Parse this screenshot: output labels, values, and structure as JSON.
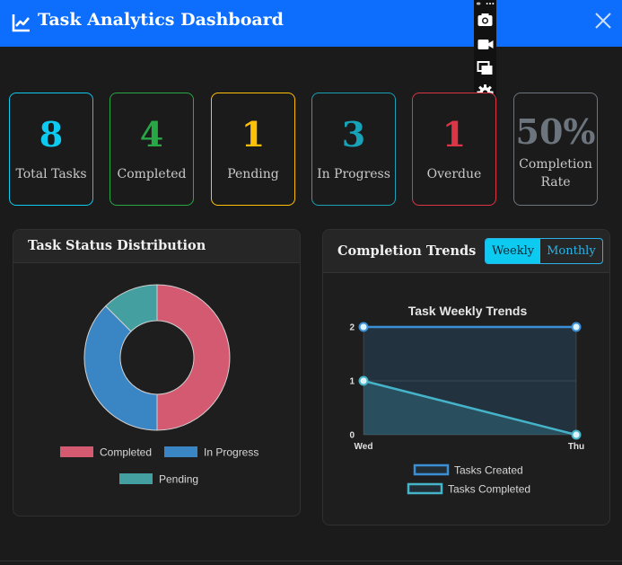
{
  "header": {
    "title": "Task Analytics Dashboard",
    "logo_icon": "chart-line-icon",
    "close_icon": "close-icon",
    "bg_color": "#0d6efd"
  },
  "recorder": {
    "icons": [
      "link-icon",
      "more-icon",
      "camera-icon",
      "video-icon",
      "window-icon",
      "gear-icon"
    ]
  },
  "stats": [
    {
      "value": "8",
      "label": "Total Tasks",
      "color": "#0dcaf0",
      "border": "#0dcaf0"
    },
    {
      "value": "4",
      "label": "Completed",
      "color": "#28a745",
      "border": "#28a745"
    },
    {
      "value": "1",
      "label": "Pending",
      "color": "#ffc107",
      "border": "#ffc107"
    },
    {
      "value": "3",
      "label": "In Progress",
      "color": "#17a2b8",
      "border": "#17a2b8"
    },
    {
      "value": "1",
      "label": "Overdue",
      "color": "#dc3545",
      "border": "#dc3545"
    },
    {
      "value": "50%",
      "label_line1": "Completion",
      "label_line2": "Rate",
      "color": "#6c757d",
      "border": "#6c757d"
    }
  ],
  "status_panel": {
    "title": "Task Status Distribution"
  },
  "trends_panel": {
    "title": "Completion Trends",
    "buttons": {
      "weekly": "Weekly",
      "monthly": "Monthly"
    },
    "active": "weekly"
  },
  "chart_data": [
    {
      "type": "pie",
      "variant": "doughnut",
      "title": "",
      "categories": [
        "Completed",
        "In Progress",
        "Pending"
      ],
      "values": [
        4,
        3,
        1
      ],
      "colors": [
        "#d45a72",
        "#3a86c4",
        "#44a0a0"
      ],
      "legend_placement": "bottom"
    },
    {
      "type": "line",
      "title": "Task Weekly Trends",
      "x": [
        "Wed",
        "Thu"
      ],
      "series": [
        {
          "name": "Tasks Created",
          "values": [
            2,
            2
          ],
          "color": "#3a8fd6"
        },
        {
          "name": "Tasks Completed",
          "values": [
            1,
            0
          ],
          "color": "#45b3c8"
        }
      ],
      "ylim": [
        0,
        2
      ],
      "yticks": [
        "0",
        "1",
        "2"
      ],
      "grid": true,
      "legend_placement": "bottom"
    }
  ]
}
